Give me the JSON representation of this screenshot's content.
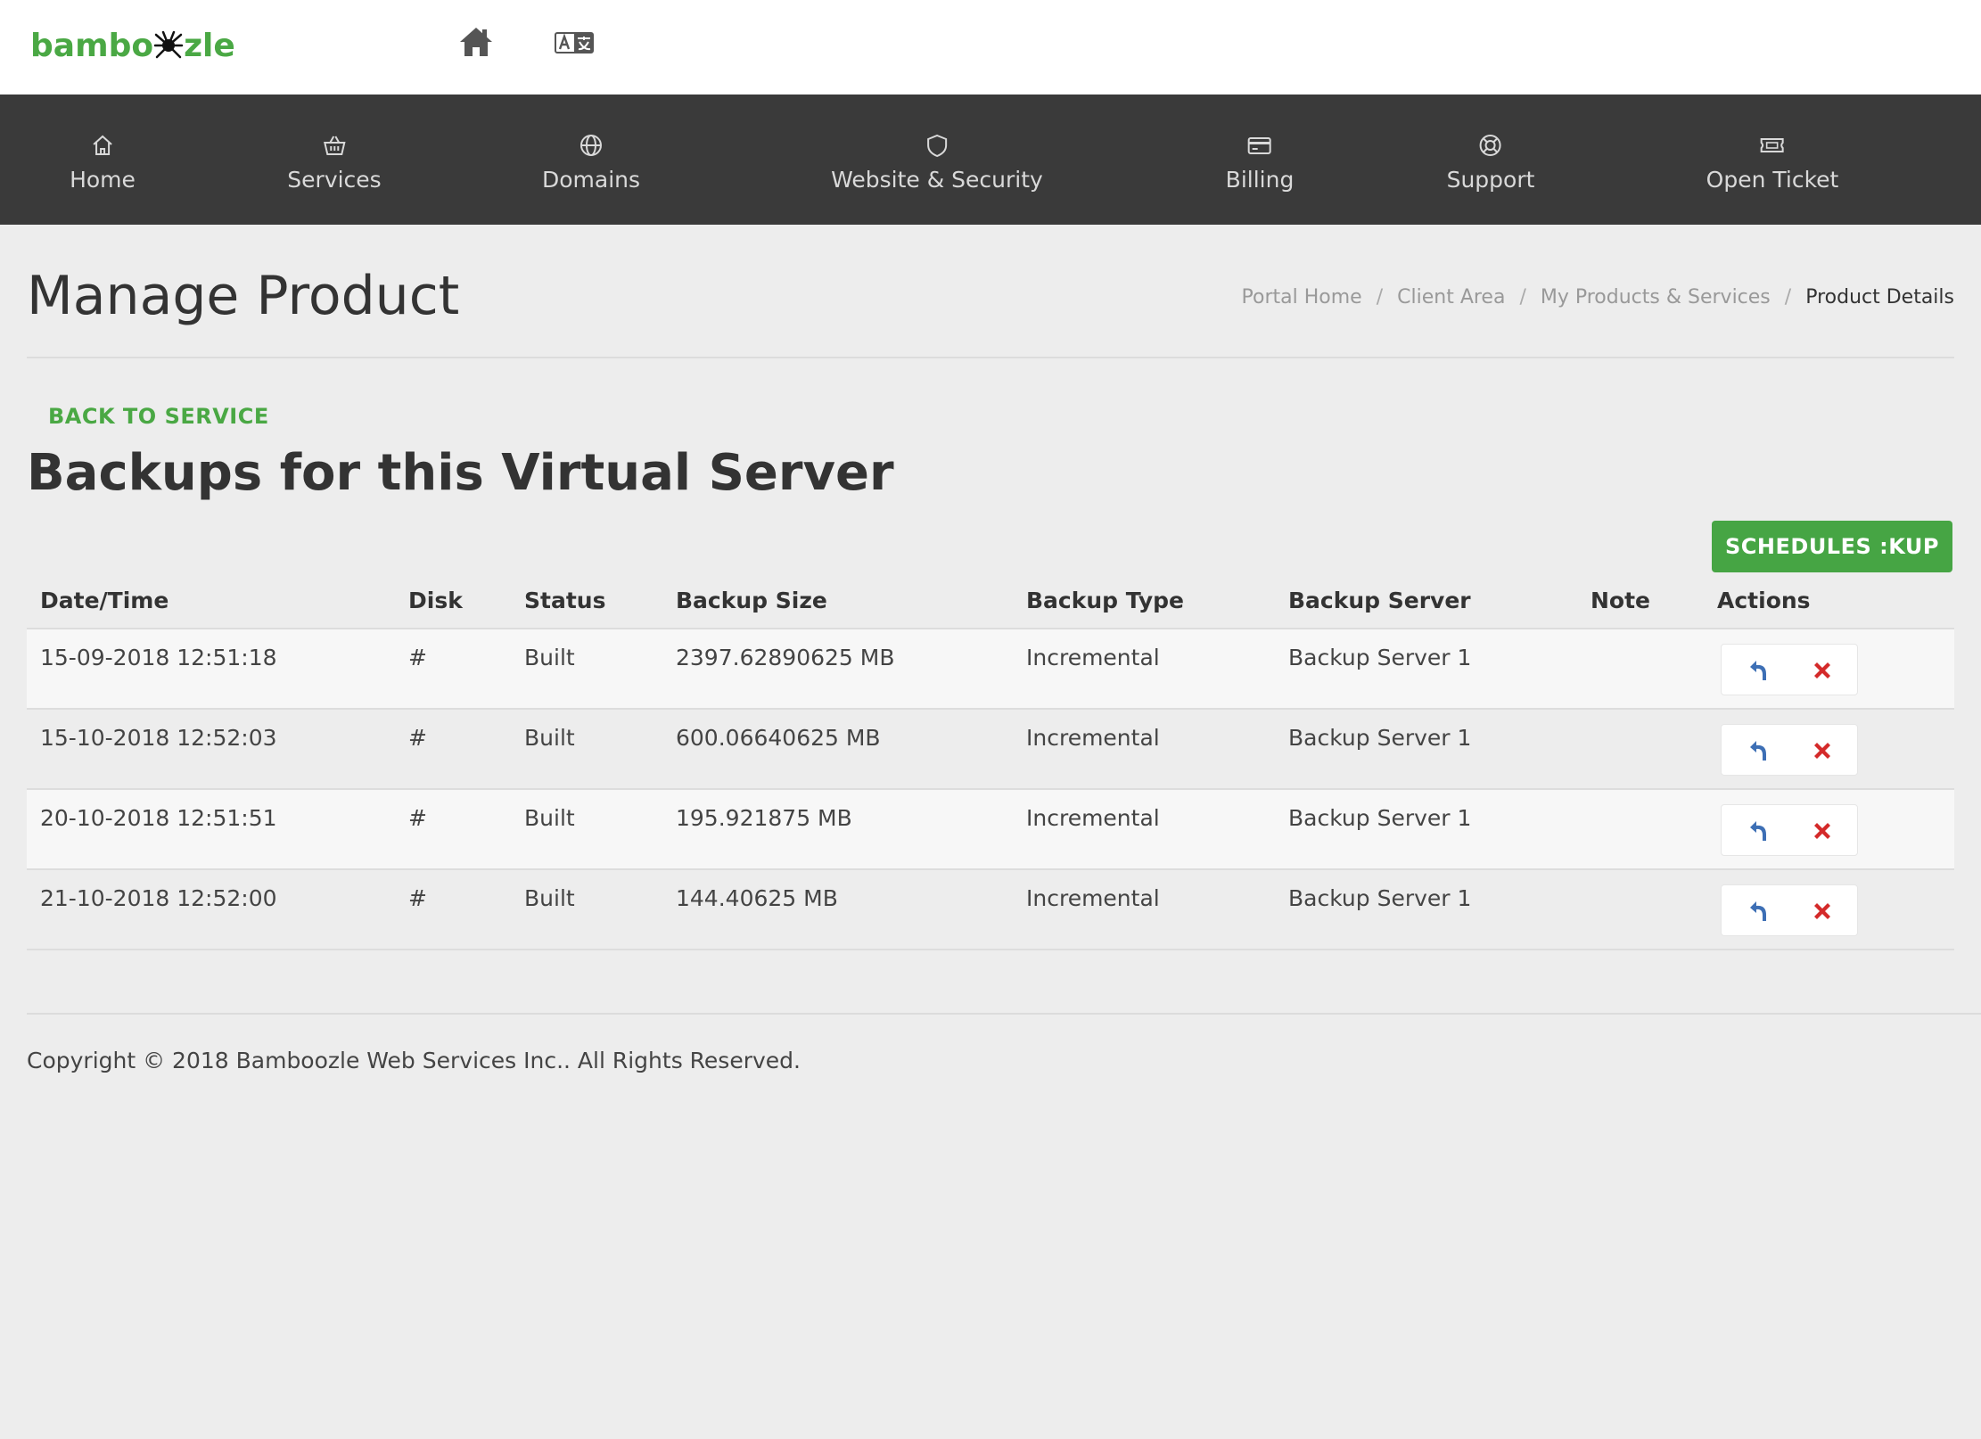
{
  "brand": {
    "logo_text_left": "bambo",
    "logo_text_right": "zle",
    "logo_icon": "spider-icon",
    "brand_color": "#4aa844"
  },
  "topbar": {
    "home_icon": "home-icon",
    "language_icon": "translate-icon"
  },
  "nav": {
    "items": [
      {
        "label": "Home",
        "icon": "home-outline-icon"
      },
      {
        "label": "Services",
        "icon": "basket-icon"
      },
      {
        "label": "Domains",
        "icon": "globe-icon"
      },
      {
        "label": "Website & Security",
        "icon": "shield-icon"
      },
      {
        "label": "Billing",
        "icon": "credit-card-icon"
      },
      {
        "label": "Support",
        "icon": "lifebuoy-icon"
      },
      {
        "label": "Open Ticket",
        "icon": "ticket-icon"
      }
    ],
    "background": "#3a3a3a"
  },
  "page": {
    "title": "Manage Product",
    "breadcrumb": [
      "Portal Home",
      "Client Area",
      "My Products & Services",
      "Product Details"
    ],
    "breadcrumb_separator": "/"
  },
  "backups": {
    "back_link": "BACK TO SERVICE",
    "title": "Backups for this Virtual Server",
    "schedule_button": "SCHEDULES  :KUP",
    "columns": [
      "Date/Time",
      "Disk",
      "Status",
      "Backup Size",
      "Backup Type",
      "Backup Server",
      "Note",
      "Actions"
    ],
    "rows": [
      {
        "datetime": "15-09-2018 12:51:18",
        "disk": "#",
        "status": "Built",
        "size": "2397.62890625 MB",
        "type": "Incremental",
        "server": "Backup Server 1",
        "note": ""
      },
      {
        "datetime": "15-10-2018 12:52:03",
        "disk": "#",
        "status": "Built",
        "size": "600.06640625 MB",
        "type": "Incremental",
        "server": "Backup Server 1",
        "note": ""
      },
      {
        "datetime": "20-10-2018 12:51:51",
        "disk": "#",
        "status": "Built",
        "size": "195.921875 MB",
        "type": "Incremental",
        "server": "Backup Server 1",
        "note": ""
      },
      {
        "datetime": "21-10-2018 12:52:00",
        "disk": "#",
        "status": "Built",
        "size": "144.40625 MB",
        "type": "Incremental",
        "server": "Backup Server 1",
        "note": ""
      }
    ],
    "row_actions": {
      "restore_icon": "restore-arrow-icon",
      "delete_icon": "delete-x-icon"
    },
    "accent_button_color": "#46a544"
  },
  "footer": {
    "copyright": "Copyright © 2018 Bamboozle Web Services Inc.. All Rights Reserved."
  }
}
